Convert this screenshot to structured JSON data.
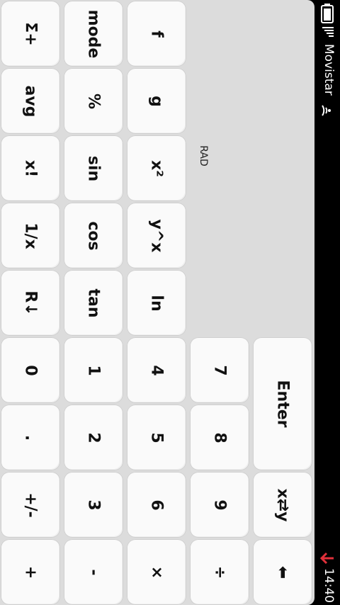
{
  "status_bar": {
    "carrier": "Movistar",
    "time": "14:40"
  },
  "calculator": {
    "angle_mode": "RAD",
    "keys": {
      "sigma_plus": "Σ+",
      "mode": "mode",
      "f": "f",
      "avg": "avg",
      "percent": "%",
      "g": "g",
      "factorial": "x!",
      "sin": "sin",
      "x_squared": "x²",
      "reciprocal": "1/x",
      "cos": "cos",
      "y_pow_x": "y^x",
      "roll_down": "R↓",
      "tan": "tan",
      "ln": "ln",
      "d0": "0",
      "d1": "1",
      "d4": "4",
      "d7": "7",
      "enter": "Enter",
      "dot": ".",
      "d2": "2",
      "d5": "5",
      "d8": "8",
      "plus_minus": "+/-",
      "d3": "3",
      "d6": "6",
      "d9": "9",
      "swap": "x⇄y",
      "add": "+",
      "subtract": "-",
      "multiply": "×",
      "divide": "÷",
      "backspace": "⬅"
    }
  }
}
